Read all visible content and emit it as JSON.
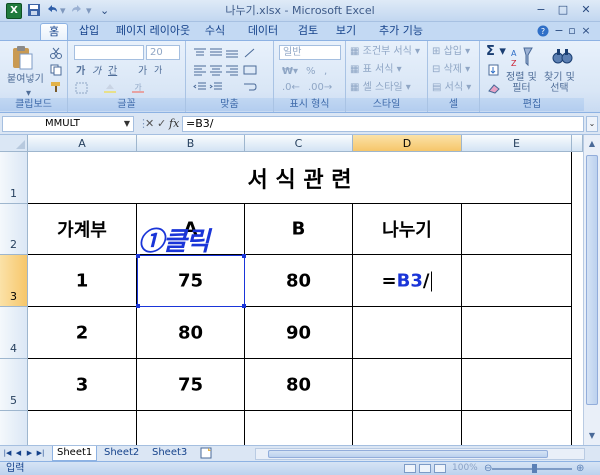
{
  "titlebar": {
    "title": "나누기.xlsx - Microsoft Excel",
    "app_icon": "X",
    "qat": [
      "save-icon",
      "undo-icon",
      "redo-icon",
      "customize-qat-icon"
    ],
    "minimize": "−",
    "maximize": "□",
    "close": "✕"
  },
  "tabs": [
    "홈",
    "삽입",
    "페이지 레이아웃",
    "수식",
    "데이터",
    "검토",
    "보기",
    "추가 기능"
  ],
  "ribbon": {
    "clipboard": {
      "paste": "붙여넣기",
      "label": "클립보드"
    },
    "font": {
      "size": "20",
      "bold": "가",
      "italic": "가",
      "underline": "간",
      "grow": "가",
      "shrink": "가",
      "label": "글꼴"
    },
    "alignment": {
      "label": "맞춤"
    },
    "number": {
      "format": "일반",
      "percent": "%",
      "comma": ",",
      "label": "표시 형식"
    },
    "styles": {
      "conditional": "조건부 서식",
      "table": "표 서식",
      "cell_style": "셀 스타일",
      "label": "스타일"
    },
    "cells": {
      "insert": "삽입",
      "delete": "삭제",
      "format": "서식",
      "label": "셀"
    },
    "editing": {
      "sort": "정렬 및\n필터",
      "find": "찾기 및\n선택",
      "label": "편집"
    }
  },
  "formula_bar": {
    "name_box": "MMULT",
    "cancel": "✕",
    "enter": "✓",
    "fx": "fx",
    "formula": "=B3/"
  },
  "sheet": {
    "columns": [
      "A",
      "B",
      "C",
      "D",
      "E"
    ],
    "rows": [
      "1",
      "2",
      "3",
      "4",
      "5"
    ],
    "title": "서 식 관 련",
    "header": [
      "가계부",
      "A",
      "B",
      "나누기"
    ],
    "data": [
      [
        "1",
        "75",
        "80"
      ],
      [
        "2",
        "80",
        "90"
      ],
      [
        "3",
        "75",
        "80"
      ]
    ],
    "editing_prefix": "=",
    "editing_ref": "B3",
    "editing_suffix": "/",
    "annotation": "①클릭"
  },
  "sheet_tabs": [
    "Sheet1",
    "Sheet2",
    "Sheet3"
  ],
  "status": {
    "mode": "입력",
    "zoom": "100%"
  },
  "colors": {
    "ref_blue": "#1a35d8",
    "active_header": "#f6c66a"
  }
}
